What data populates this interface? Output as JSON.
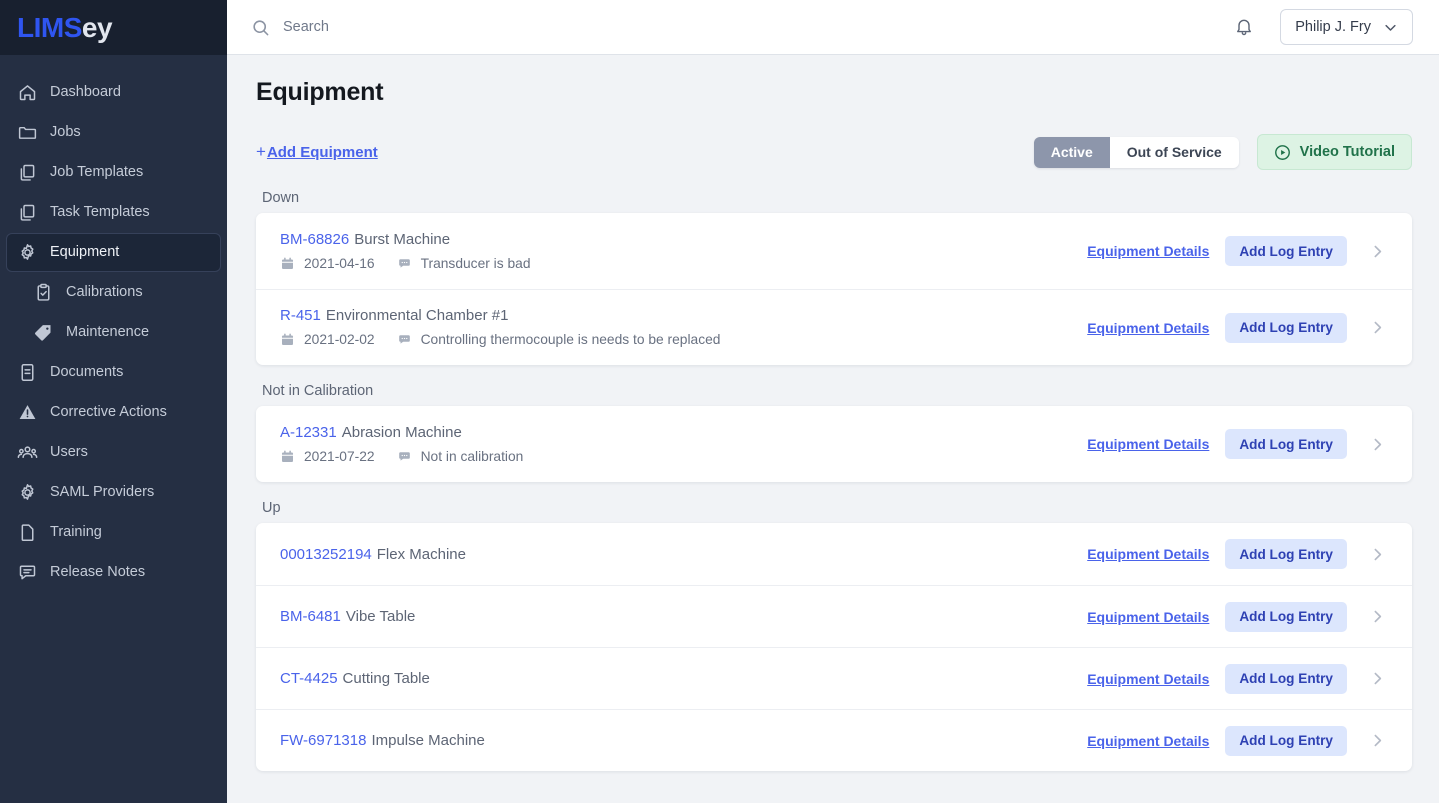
{
  "brand": {
    "name_primary": "LIMS",
    "name_secondary": "ey"
  },
  "sidebar": {
    "items": [
      {
        "label": "Dashboard",
        "icon": "home-icon",
        "sub": false,
        "active": false
      },
      {
        "label": "Jobs",
        "icon": "folder-icon",
        "sub": false,
        "active": false
      },
      {
        "label": "Job Templates",
        "icon": "copy-icon",
        "sub": false,
        "active": false
      },
      {
        "label": "Task Templates",
        "icon": "copy-icon",
        "sub": false,
        "active": false
      },
      {
        "label": "Equipment",
        "icon": "gear-icon",
        "sub": false,
        "active": true
      },
      {
        "label": "Calibrations",
        "icon": "clipboard-check-icon",
        "sub": true,
        "active": false
      },
      {
        "label": "Maintenence",
        "icon": "tag-icon",
        "sub": true,
        "active": false
      },
      {
        "label": "Documents",
        "icon": "document-icon",
        "sub": false,
        "active": false
      },
      {
        "label": "Corrective Actions",
        "icon": "warning-triangle-icon",
        "sub": false,
        "active": false
      },
      {
        "label": "Users",
        "icon": "users-icon",
        "sub": false,
        "active": false
      },
      {
        "label": "SAML Providers",
        "icon": "gear-icon",
        "sub": false,
        "active": false
      },
      {
        "label": "Training",
        "icon": "page-icon",
        "sub": false,
        "active": false
      },
      {
        "label": "Release Notes",
        "icon": "comment-icon",
        "sub": false,
        "active": false
      }
    ]
  },
  "topbar": {
    "search_placeholder": "Search",
    "search_value": "",
    "user_name": "Philip J. Fry"
  },
  "page": {
    "title": "Equipment",
    "add_equipment_label": "Add Equipment",
    "add_equipment_plus": "+",
    "toggles": [
      {
        "label": "Active",
        "selected": true
      },
      {
        "label": "Out of Service",
        "selected": false
      }
    ],
    "video_tutorial_label": "Video Tutorial"
  },
  "row_actions": {
    "details_label": "Equipment Details",
    "log_label": "Add Log Entry"
  },
  "groups": [
    {
      "label": "Down",
      "rows": [
        {
          "code": "BM-68826",
          "name": "Burst Machine",
          "date": "2021-04-16",
          "comment": "Transducer is bad"
        },
        {
          "code": "R-451",
          "name": "Environmental Chamber #1",
          "date": "2021-02-02",
          "comment": "Controlling thermocouple is needs to be replaced"
        }
      ]
    },
    {
      "label": "Not in Calibration",
      "rows": [
        {
          "code": "A-12331",
          "name": "Abrasion Machine",
          "date": "2021-07-22",
          "comment": "Not in calibration"
        }
      ]
    },
    {
      "label": "Up",
      "rows": [
        {
          "code": "00013252194",
          "name": "Flex Machine",
          "date": "",
          "comment": ""
        },
        {
          "code": "BM-6481",
          "name": "Vibe Table",
          "date": "",
          "comment": ""
        },
        {
          "code": "CT-4425",
          "name": "Cutting Table",
          "date": "",
          "comment": ""
        },
        {
          "code": "FW-6971318",
          "name": "Impulse Machine",
          "date": "",
          "comment": ""
        }
      ]
    }
  ],
  "colors": {
    "brand_blue": "#2f55f0",
    "link_blue": "#4a63ea",
    "sidebar_bg": "#252f43",
    "sidebar_logo_bg": "#18202f",
    "page_bg": "#f1f3f6",
    "toggle_active_bg": "#8d96ab",
    "video_btn_bg": "#ddf3e4",
    "video_btn_text": "#20724a",
    "log_btn_bg": "#dce6fd"
  }
}
